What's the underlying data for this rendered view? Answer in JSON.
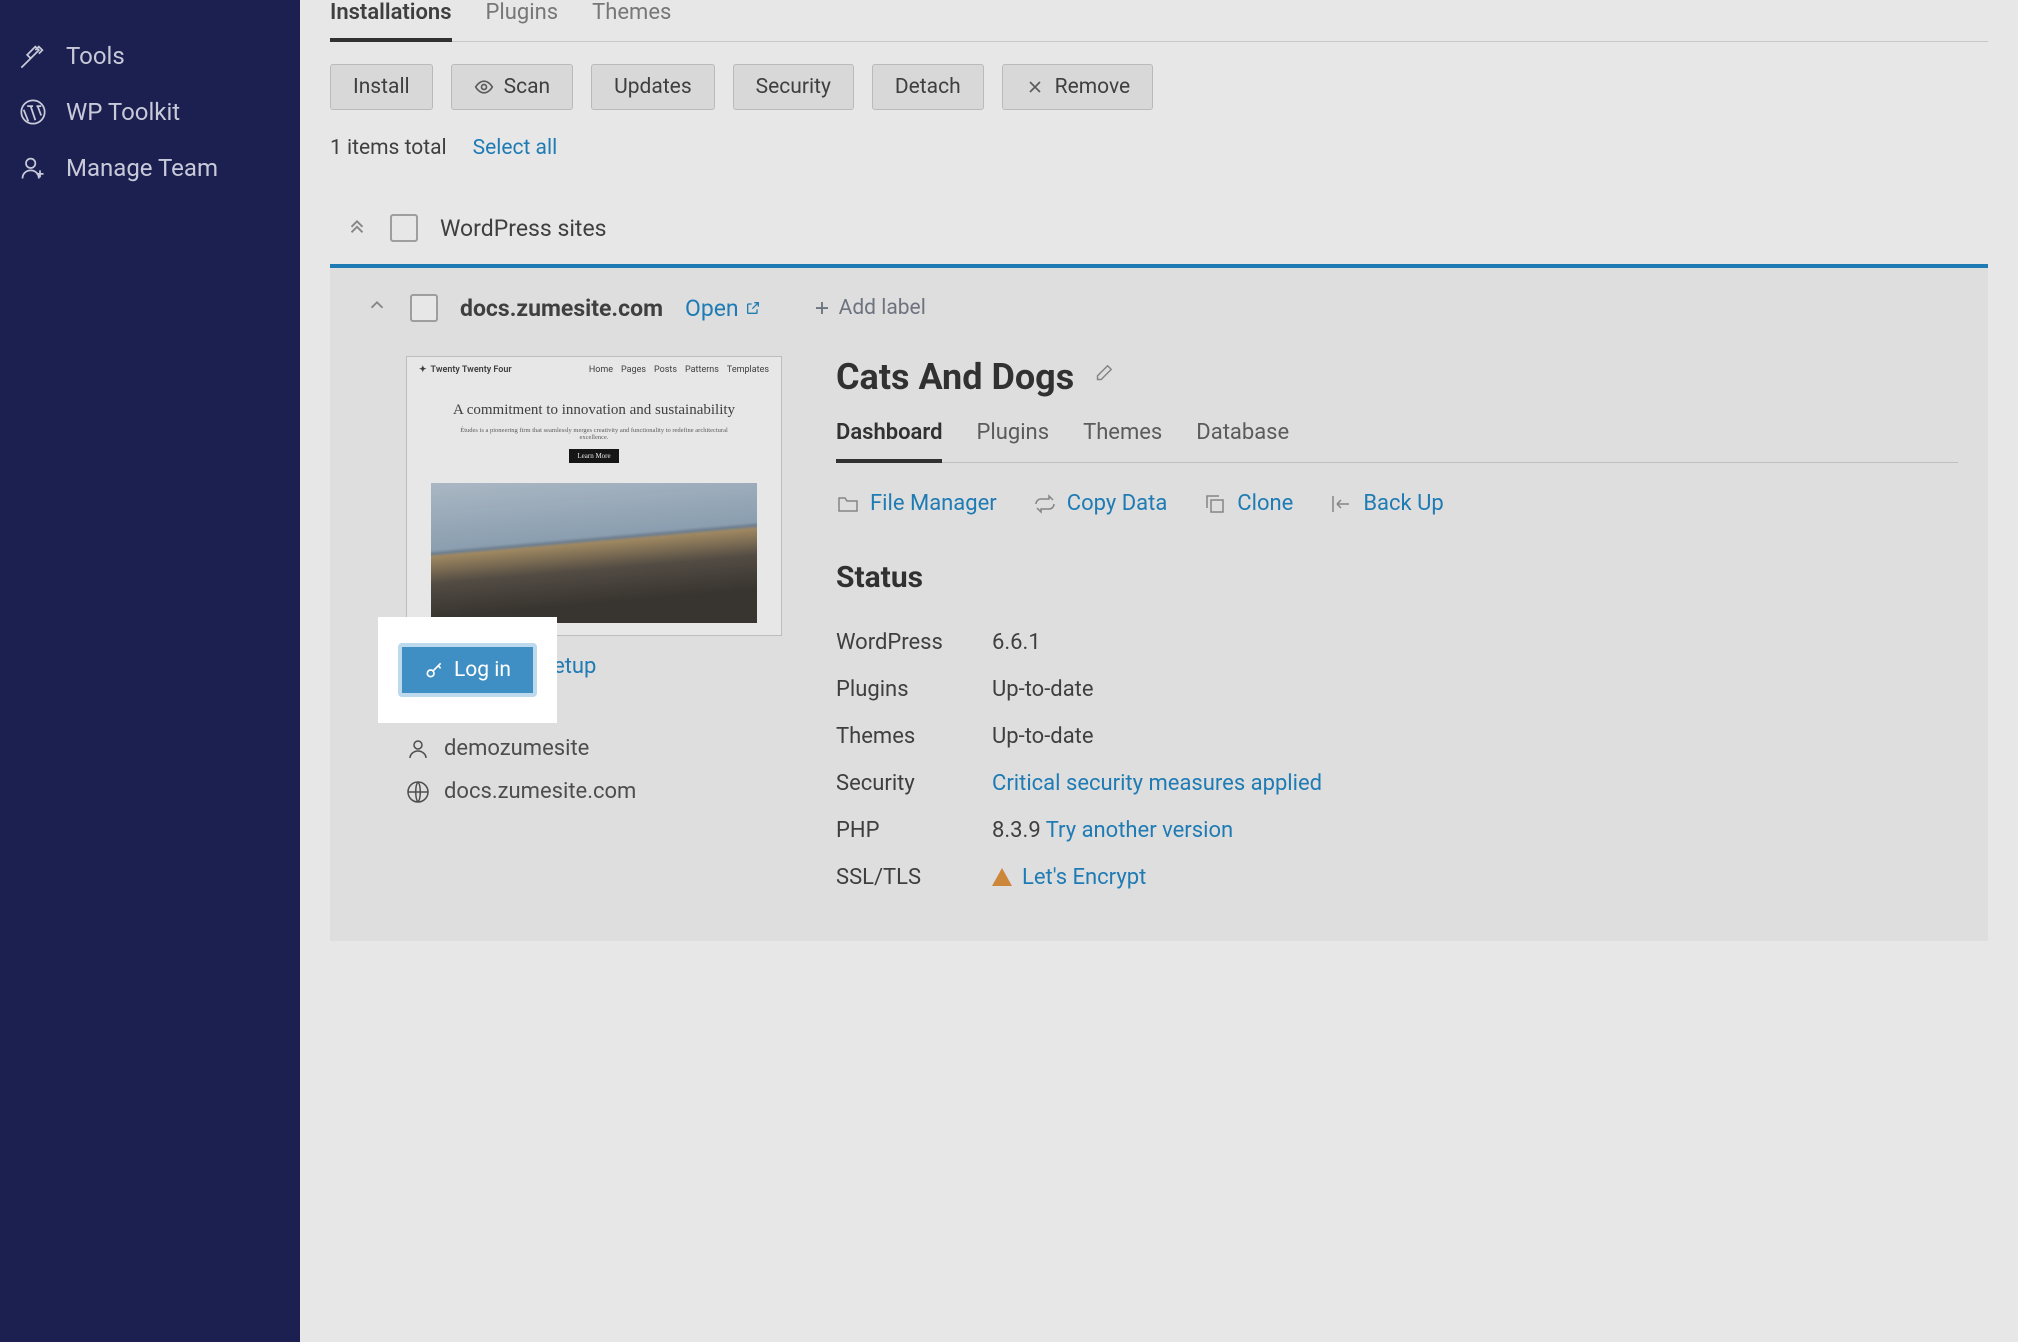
{
  "sidebar": {
    "items": [
      {
        "label": "Tools"
      },
      {
        "label": "WP Toolkit"
      },
      {
        "label": "Manage Team"
      }
    ]
  },
  "tabs": {
    "items": [
      {
        "label": "Installations"
      },
      {
        "label": "Plugins"
      },
      {
        "label": "Themes"
      }
    ]
  },
  "toolbar": {
    "install": "Install",
    "scan": "Scan",
    "updates": "Updates",
    "security": "Security",
    "detach": "Detach",
    "remove": "Remove"
  },
  "items_total": "1 items total",
  "select_all": "Select all",
  "group_title": "WordPress sites",
  "site": {
    "domain": "docs.zumesite.com",
    "open": "Open",
    "add_label": "Add label",
    "preview": {
      "theme_name": "Twenty Twenty Four",
      "nav": [
        "Home",
        "Pages",
        "Posts",
        "Patterns",
        "Templates"
      ],
      "hero_title": "A commitment to innovation and sustainability",
      "hero_sub": "Études is a pioneering firm that seamlessly merges creativity and functionality to redefine architectural excellence.",
      "cta": "Learn More"
    },
    "login": "Log in",
    "setup": "Setup",
    "user": "demozumesite",
    "host": "docs.zumesite.com",
    "title": "Cats And Dogs",
    "sub_tabs": [
      "Dashboard",
      "Plugins",
      "Themes",
      "Database"
    ],
    "actions": {
      "file_manager": "File Manager",
      "copy_data": "Copy Data",
      "clone": "Clone",
      "back_up": "Back Up"
    },
    "status_heading": "Status",
    "status": {
      "wordpress_label": "WordPress",
      "wordpress_value": "6.6.1",
      "plugins_label": "Plugins",
      "plugins_value": "Up-to-date",
      "themes_label": "Themes",
      "themes_value": "Up-to-date",
      "security_label": "Security",
      "security_value": "Critical security measures applied",
      "php_label": "PHP",
      "php_value": "8.3.9 ",
      "php_link": "Try another version",
      "ssl_label": "SSL/TLS",
      "ssl_value": "Let's Encrypt"
    }
  }
}
